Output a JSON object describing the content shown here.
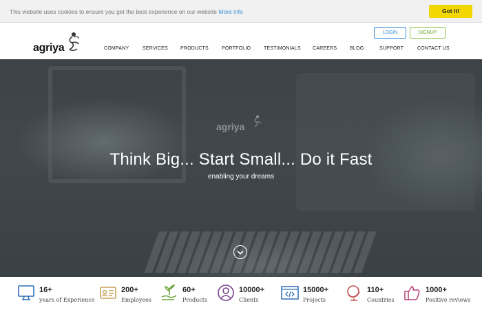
{
  "cookie": {
    "message": "This website uses cookies to ensure you get the best experience on our website",
    "link": "More info",
    "button": "Got it!"
  },
  "header": {
    "logo": "agriya",
    "login": "LOGIN",
    "signup": "SIGNUP",
    "nav": [
      "COMPANY",
      "SERVICES",
      "PRODUCTS",
      "PORTFOLIO",
      "TESTIMONIALS",
      "CAREERS",
      "BLOG",
      "SUPPORT",
      "CONTACT US"
    ]
  },
  "hero": {
    "logo": "agriya",
    "title": "Think Big... Start Small... Do it Fast",
    "subtitle": "enabling your dreams"
  },
  "stats": [
    {
      "num": "16+",
      "label": "years of Experience",
      "icon": "monitor-icon",
      "color": "#2f6fb5"
    },
    {
      "num": "200+",
      "label": "Employees",
      "icon": "id-card-icon",
      "color": "#c8a25a"
    },
    {
      "num": "60+",
      "label": "Products",
      "icon": "plant-hand-icon",
      "color": "#6aa336"
    },
    {
      "num": "10000+",
      "label": "Clients",
      "icon": "user-circle-icon",
      "color": "#7b3f8f"
    },
    {
      "num": "15000+",
      "label": "Projects",
      "icon": "code-window-icon",
      "color": "#2f6fb5"
    },
    {
      "num": "110+",
      "label": "Countries",
      "icon": "globe-icon",
      "color": "#c0504d"
    },
    {
      "num": "1000+",
      "label": "Positive reviews",
      "icon": "thumbs-up-icon",
      "color": "#b5437a"
    }
  ]
}
